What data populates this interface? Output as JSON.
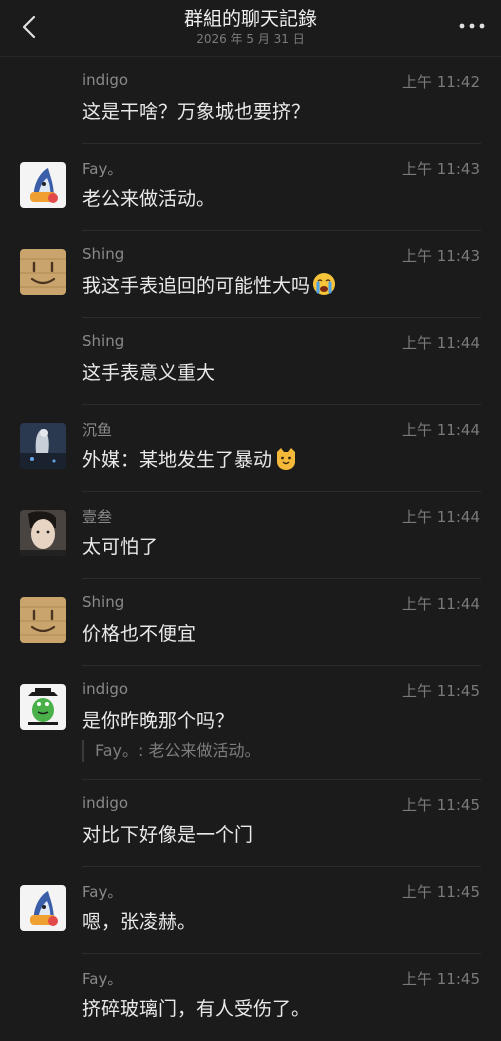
{
  "header": {
    "title": "群組的聊天記錄",
    "subtitle": "2026 年 5 月 31 日"
  },
  "messages": [
    {
      "sender": "indigo",
      "time": "上午 11:42",
      "text": "这是干啥？万象城也要挤？",
      "avatar": ""
    },
    {
      "sender": "Fay。",
      "time": "上午 11:43",
      "text": "老公来做活动。",
      "avatar": "shark-avatar"
    },
    {
      "sender": "Shing",
      "time": "上午 11:43",
      "text": "我这手表追回的可能性大吗",
      "emoji": "crying-face-emoji",
      "avatar": "wood-face-avatar"
    },
    {
      "sender": "Shing",
      "time": "上午 11:44",
      "text": "这手表意义重大",
      "avatar": ""
    },
    {
      "sender": "沉鱼",
      "time": "上午 11:44",
      "text": "外媒：某地发生了暴动",
      "emoji": "cat-face-emoji",
      "avatar": "figure-avatar"
    },
    {
      "sender": "壹叁",
      "time": "上午 11:44",
      "text": "太可怕了",
      "avatar": "person-avatar"
    },
    {
      "sender": "Shing",
      "time": "上午 11:44",
      "text": "价格也不便宜",
      "avatar": "wood-face-avatar"
    },
    {
      "sender": "indigo",
      "time": "上午 11:45",
      "text": "是你昨晚那个吗？",
      "quote": "Fay。: 老公来做活动。",
      "avatar": "frog-avatar"
    },
    {
      "sender": "indigo",
      "time": "上午 11:45",
      "text": "对比下好像是一个门",
      "avatar": ""
    },
    {
      "sender": "Fay。",
      "time": "上午 11:45",
      "text": "嗯，张凌赫。",
      "avatar": "shark-avatar"
    },
    {
      "sender": "Fay。",
      "time": "上午 11:45",
      "text": "挤碎玻璃门，有人受伤了。",
      "avatar": ""
    }
  ]
}
